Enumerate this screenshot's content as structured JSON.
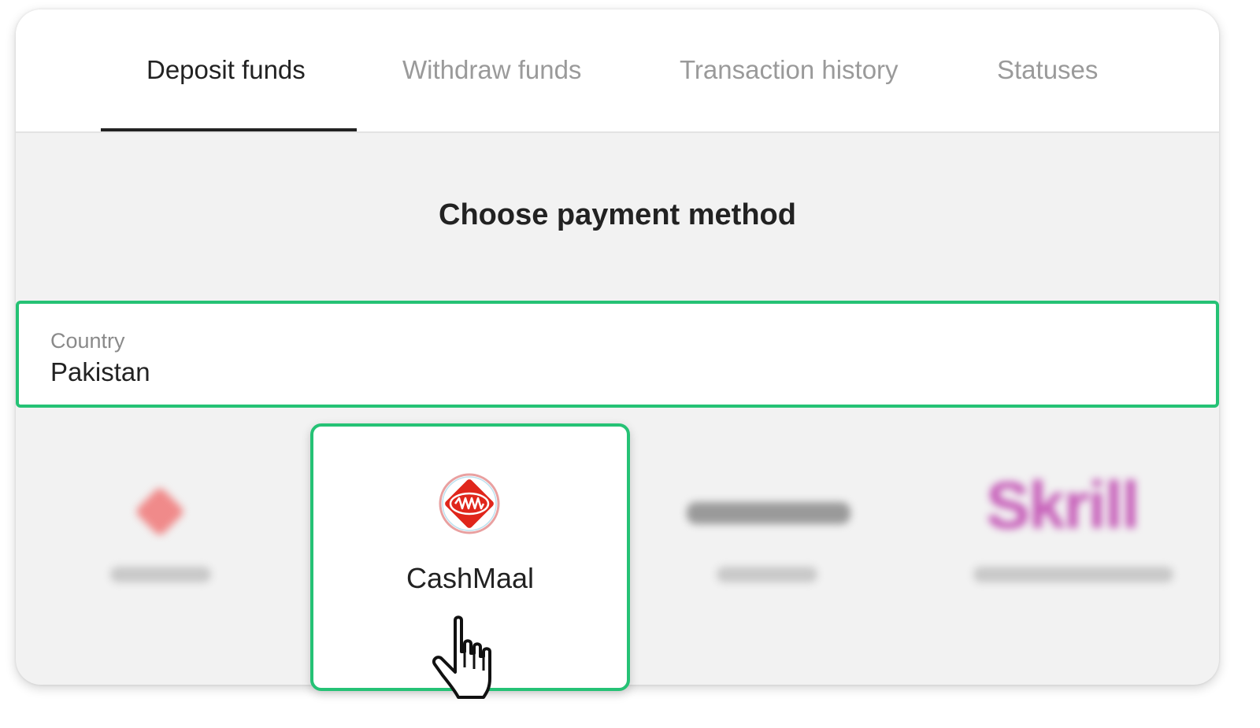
{
  "tabs": [
    {
      "label": "Deposit funds",
      "active": true
    },
    {
      "label": "Withdraw funds",
      "active": false
    },
    {
      "label": "Transaction history",
      "active": false
    },
    {
      "label": "Statuses",
      "active": false
    }
  ],
  "heading": "Choose payment method",
  "country": {
    "label": "Country",
    "value": "Pakistan"
  },
  "selected_method": {
    "name": "CashMaal",
    "icon": "cashmaal-logo-icon"
  },
  "blurred_methods": {
    "skrill_logo": "Skrill"
  },
  "colors": {
    "accent": "#25c275",
    "active_tab": "#222222",
    "inactive_tab": "#9a9a9a",
    "cashmaal_red": "#e0261b",
    "skrill_purple": "#c55ab7"
  }
}
